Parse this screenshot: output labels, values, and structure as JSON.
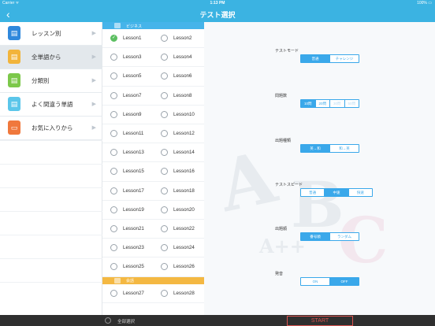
{
  "status": {
    "carrier": "Carrier ᯤ",
    "time": "1:13 PM",
    "battery": "100% ▭"
  },
  "nav": {
    "back_icon": "chevron-left-icon",
    "back_glyph": "‹",
    "title": "テスト選択"
  },
  "sidebar": {
    "items": [
      {
        "label": "レッスン別",
        "icon": "document-icon",
        "color": "#2f88dc"
      },
      {
        "label": "全単語から",
        "icon": "document-icon",
        "color": "#f2b43a",
        "active": true
      },
      {
        "label": "分類別",
        "icon": "document-icon",
        "color": "#7cc84a"
      },
      {
        "label": "よく間違う単語",
        "icon": "document-icon",
        "color": "#5bc6ea"
      },
      {
        "label": "お気に入りから",
        "icon": "folder-icon",
        "color": "#f0783c"
      }
    ]
  },
  "lesson_list": {
    "sections": [
      {
        "title": "ビジネス",
        "color": "#45b4ea"
      },
      {
        "title": "会話",
        "color": "#f4b842"
      }
    ],
    "rows": [
      [
        {
          "label": "Lesson1",
          "checked": true
        },
        {
          "label": "Lesson2",
          "checked": false
        }
      ],
      [
        {
          "label": "Lesson3",
          "checked": false
        },
        {
          "label": "Lesson4",
          "checked": false
        }
      ],
      [
        {
          "label": "Lesson5",
          "checked": false
        },
        {
          "label": "Lesson6",
          "checked": false
        }
      ],
      [
        {
          "label": "Lesson7",
          "checked": false
        },
        {
          "label": "Lesson8",
          "checked": false
        }
      ],
      [
        {
          "label": "Lesson9",
          "checked": false
        },
        {
          "label": "Lesson10",
          "checked": false
        }
      ],
      [
        {
          "label": "Lesson11",
          "checked": false
        },
        {
          "label": "Lesson12",
          "checked": false
        }
      ],
      [
        {
          "label": "Lesson13",
          "checked": false
        },
        {
          "label": "Lesson14",
          "checked": false
        }
      ],
      [
        {
          "label": "Lesson15",
          "checked": false
        },
        {
          "label": "Lesson16",
          "checked": false
        }
      ],
      [
        {
          "label": "Lesson17",
          "checked": false
        },
        {
          "label": "Lesson18",
          "checked": false
        }
      ],
      [
        {
          "label": "Lesson19",
          "checked": false
        },
        {
          "label": "Lesson20",
          "checked": false
        }
      ],
      [
        {
          "label": "Lesson21",
          "checked": false
        },
        {
          "label": "Lesson22",
          "checked": false
        }
      ],
      [
        {
          "label": "Lesson23",
          "checked": false
        },
        {
          "label": "Lesson24",
          "checked": false
        }
      ],
      [
        {
          "label": "Lesson25",
          "checked": false
        },
        {
          "label": "Lesson26",
          "checked": false
        }
      ],
      [
        {
          "label": "Lesson27",
          "checked": false
        },
        {
          "label": "Lesson28",
          "checked": false
        }
      ]
    ]
  },
  "settings": {
    "test_mode": {
      "label": "テストモード",
      "options": [
        "普通",
        "チャレンジ"
      ],
      "selected": 0
    },
    "question_count": {
      "label": "問題数",
      "options": [
        "10問",
        "20問",
        "30問",
        "50問"
      ],
      "selected": 0
    },
    "question_type": {
      "label": "出題種類",
      "options": [
        "英→和",
        "和→英"
      ],
      "selected": 0
    },
    "test_speed": {
      "label": "テストスピード",
      "options": [
        "普通",
        "中速",
        "快速"
      ],
      "selected": 1
    },
    "question_order": {
      "label": "出題順",
      "options": [
        "番号順",
        "ランダム"
      ],
      "selected": 0
    },
    "pronunciation": {
      "label": "発音",
      "options": [
        "ON",
        "OFF"
      ],
      "selected": 1
    }
  },
  "bottom": {
    "select_all_label": "全部選択",
    "start_label": "START"
  },
  "colors": {
    "header": "#3bb3e2",
    "accent": "#3aa8ea",
    "check": "#5cbf62",
    "start": "#d9534f"
  }
}
